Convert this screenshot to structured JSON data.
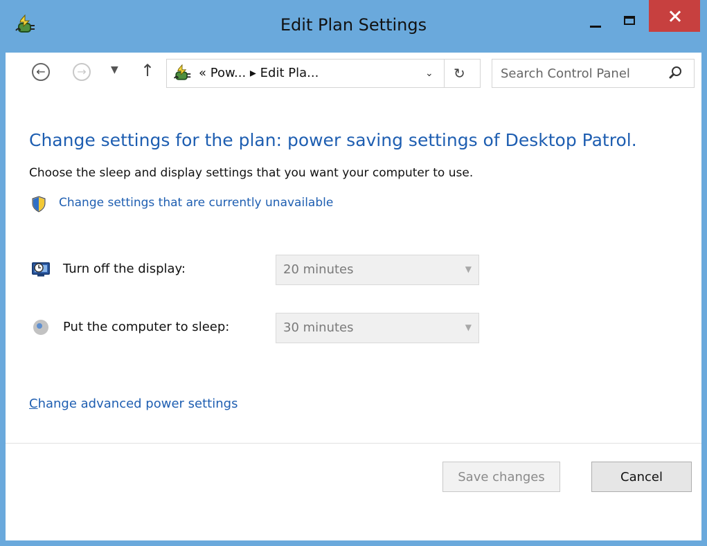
{
  "window": {
    "title": "Edit Plan Settings",
    "colors": {
      "frame": "#6aa9dc",
      "close": "#c7403f",
      "link": "#1e5eb1"
    }
  },
  "navigation": {
    "back_icon": "back-arrow-icon",
    "forward_icon": "forward-arrow-icon",
    "up_icon": "up-arrow-icon",
    "address": {
      "icon": "power-options-icon",
      "path": "« Pow... ▸ Edit Pla..."
    },
    "search": {
      "placeholder": "Search Control Panel"
    }
  },
  "content": {
    "heading": "Change settings for the plan: power saving settings of Desktop Patrol.",
    "subheading": "Choose the sleep and display settings that you want your computer to use.",
    "unavailable_link": "Change settings that are currently unavailable",
    "settings": [
      {
        "label": "Turn off the display:",
        "value": "20 minutes",
        "icon": "display-icon"
      },
      {
        "label": "Put the computer to sleep:",
        "value": "30 minutes",
        "icon": "sleep-moon-icon"
      }
    ],
    "advanced_link": {
      "first_letter": "C",
      "rest": "hange advanced power settings"
    }
  },
  "footer": {
    "save_label": "Save changes",
    "cancel_label": "Cancel"
  }
}
